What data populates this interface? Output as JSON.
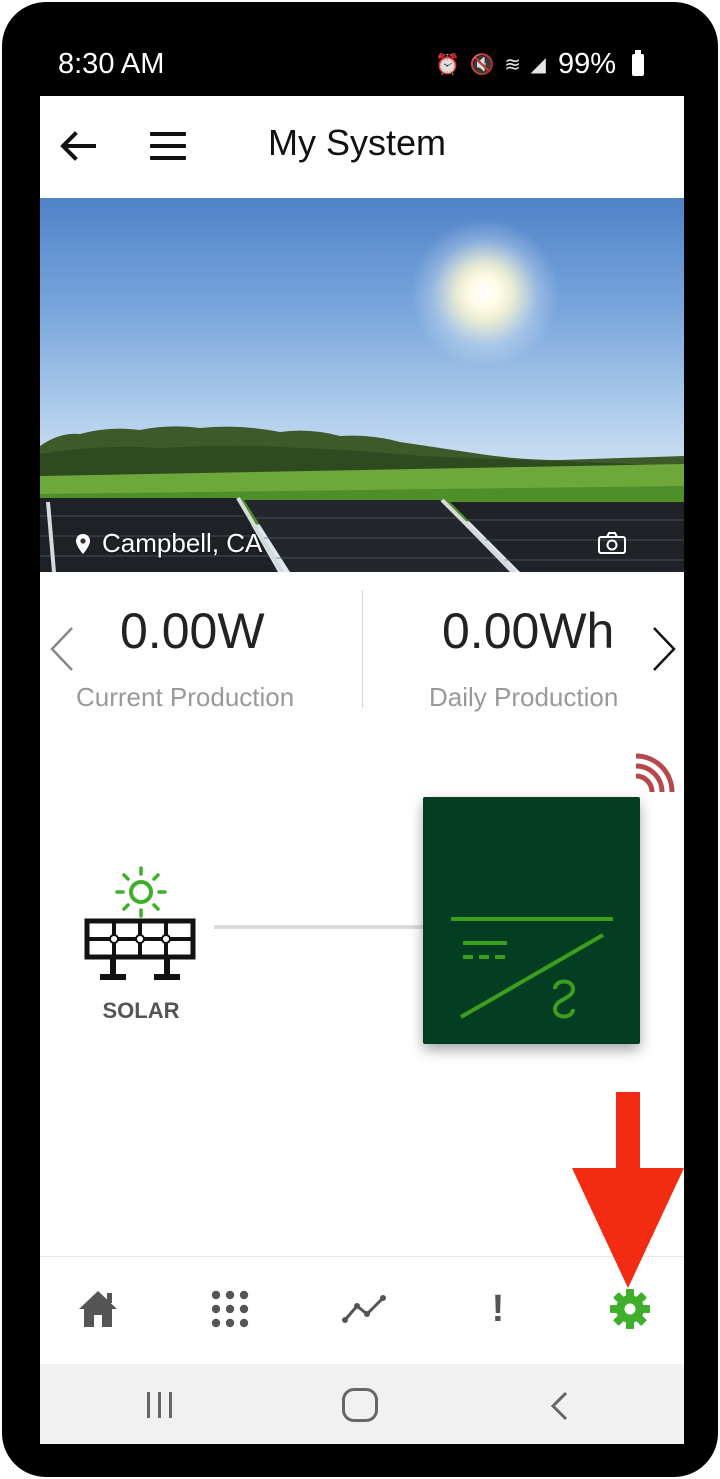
{
  "status_bar": {
    "time": "8:30 AM",
    "battery": "99%",
    "icons": [
      "alarm-icon",
      "mute-icon",
      "wifi-icon",
      "signal-icon",
      "battery-icon"
    ]
  },
  "header": {
    "title": "My System",
    "back_icon": "back-arrow-icon",
    "menu_icon": "hamburger-menu-icon"
  },
  "hero": {
    "location": "Campbell, CA",
    "location_icon": "map-pin-icon",
    "camera_icon": "camera-icon"
  },
  "stats": [
    {
      "value": "0.00W",
      "label": "Current Production"
    },
    {
      "value": "0.00Wh",
      "label": "Daily Production"
    }
  ],
  "diagram": {
    "solar_label": "SOLAR",
    "colors": {
      "inverter_bg": "#033d22",
      "inverter_lines": "#3a9e1e",
      "sun": "#3fae2a",
      "signal": "#b5484b"
    }
  },
  "bottom_nav": [
    {
      "name": "home",
      "icon": "home-icon"
    },
    {
      "name": "devices",
      "icon": "grid-icon"
    },
    {
      "name": "charts",
      "icon": "line-chart-icon"
    },
    {
      "name": "alerts",
      "icon": "alert-icon",
      "glyph": "!"
    },
    {
      "name": "settings",
      "icon": "gear-icon",
      "active": true,
      "color": "#3fae2a"
    }
  ],
  "annotation": {
    "arrow_color": "#f22b12"
  }
}
